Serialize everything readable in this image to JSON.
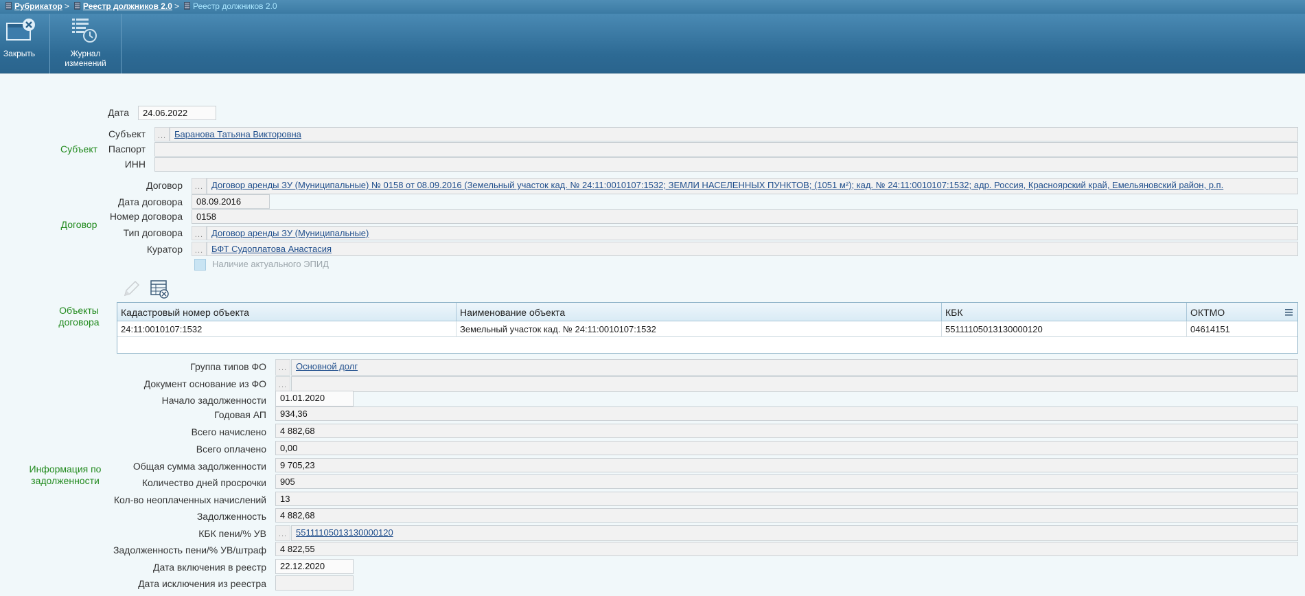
{
  "breadcrumbs": {
    "item1": "Рубрикатор",
    "item2": "Реестр должников 2.0",
    "current": "Реестр должников 2.0",
    "separator": ">"
  },
  "toolbar": {
    "close_label": "Закрыть",
    "journal_label_line1": "Журнал",
    "journal_label_line2": "изменений"
  },
  "top": {
    "date_label": "Дата",
    "date_value": "24.06.2022"
  },
  "subject": {
    "group_label": "Субъект",
    "subject_label": "Субъект",
    "subject_value": "Баранова Татьяна Викторовна",
    "passport_label": "Паспорт",
    "passport_value": "",
    "inn_label": "ИНН",
    "inn_value": ""
  },
  "contract": {
    "group_label": "Договор",
    "contract_label": "Договор",
    "contract_value": "Договор аренды ЗУ (Муниципальные) № 0158 от 08.09.2016 (Земельный участок кад. № 24:11:0010107:1532; ЗЕМЛИ НАСЕЛЕННЫХ ПУНКТОВ; (1051 м²); кад. № 24:11:0010107:1532; адр. Россия, Красноярский край, Емельяновский район, р.п.",
    "date_label": "Дата договора",
    "date_value": "08.09.2016",
    "number_label": "Номер договора",
    "number_value": "0158",
    "type_label": "Тип договора",
    "type_value": "Договор аренды ЗУ (Муниципальные)",
    "curator_label": "Куратор",
    "curator_value": "БФТ Судоплатова Анастасия",
    "epid_label": "Наличие актуального ЭПИД",
    "epid_checked": false
  },
  "objects": {
    "group_label_line1": "Объекты",
    "group_label_line2": "договора",
    "columns": [
      "Кадастровый номер объекта",
      "Наименование объекта",
      "КБК",
      "ОКТМО"
    ],
    "rows": [
      [
        "24:11:0010107:1532",
        "Земельный участок кад. № 24:11:0010107:1532",
        "55111105013130000120",
        "04614151"
      ]
    ]
  },
  "debt": {
    "group_label_line1": "Информация по",
    "group_label_line2": "задолженности",
    "fo_group_label": "Группа типов ФО",
    "fo_group_value": "Основной долг",
    "fo_doc_label": "Документ основание из ФО",
    "fo_doc_value": "",
    "start_label": "Начало задолженности",
    "start_value": "01.01.2020",
    "annual_label": "Годовая АП",
    "annual_value": "934,36",
    "accrued_label": "Всего начислено",
    "accrued_value": "4 882,68",
    "paid_label": "Всего оплачено",
    "paid_value": "0,00",
    "total_label": "Общая сумма задолженности",
    "total_value": "9 705,23",
    "overdue_label": "Количество дней просрочки",
    "overdue_value": "905",
    "unpaid_label": "Кол-во неоплаченных начислений",
    "unpaid_value": "13",
    "debt_label": "Задолженность",
    "debt_value": "4 882,68",
    "kbk_label": "КБК пени/% УВ",
    "kbk_value": "55111105013130000120",
    "penalty_label": "Задолженность пени/% УВ/штраф",
    "penalty_value": "4 822,55",
    "include_label": "Дата включения в реестр",
    "include_value": "22.12.2020",
    "exclude_label": "Дата исключения из реестра",
    "exclude_value": ""
  },
  "colors": {
    "accent": "#3b7aa3",
    "group_label": "#218a1d",
    "link": "#1f4e8c"
  }
}
